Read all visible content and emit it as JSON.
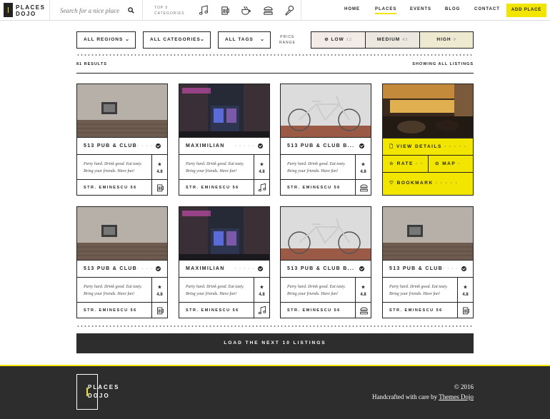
{
  "brand": {
    "line1": "PLACES",
    "line2": "DOJO"
  },
  "search": {
    "placeholder": "Search for a nice place"
  },
  "top_categories": {
    "line1": "TOP 5",
    "line2": "CATEGORIES",
    "icons": [
      "music-note-icon",
      "beer-mug-icon",
      "coffee-cup-icon",
      "burger-icon",
      "ice-cream-icon"
    ]
  },
  "nav": {
    "home": "HOME",
    "places": "PLACES",
    "events": "EVENTS",
    "blog": "BLOG",
    "contact": "CONTACT",
    "add_place": "ADD PLACE"
  },
  "filters": {
    "regions": "ALL REGIONS",
    "categories": "ALL CATEGORIES",
    "tags": "ALL TAGS",
    "price_label_1": "PRICE",
    "price_label_2": "RANGE"
  },
  "price": [
    {
      "label": "LOW",
      "count": "12"
    },
    {
      "label": "MEDIUM",
      "count": "43"
    },
    {
      "label": "HIGH",
      "count": "9"
    }
  ],
  "results": {
    "count": "81 RESULTS",
    "showing": "SHOWING ALL LISTINGS"
  },
  "cards": [
    {
      "title": "513 PUB & CLUB",
      "dots": "· · · ·",
      "desc": "Party hard. Drink good. Eat tasty. Bring your friends. Have fun!",
      "rating_star": "★",
      "rating": "4.8",
      "address": "STR. EMINESCU 56",
      "icon": "beer-mug-icon"
    },
    {
      "title": "MAXIMILIAN",
      "dots": "· · · · ·",
      "desc": "Party hard. Drink good. Eat tasty. Bring your friends. Have fun!",
      "rating_star": "★",
      "rating": "4.8",
      "address": "STR. EMINESCU 56",
      "icon": "music-note-icon"
    },
    {
      "title": "513 PUB & CLUB B...",
      "dots": "",
      "desc": "Party hard. Drink good. Eat tasty. Bring your friends. Have fun!",
      "rating_star": "★",
      "rating": "4.8",
      "address": "STR. EMINESCU 56",
      "icon": "burger-icon"
    },
    {
      "overlay": {
        "view": "VIEW DETAILS",
        "rate": "RATE",
        "map": "MAP",
        "bookmark": "BOOKMARK"
      }
    },
    {
      "title": "513 PUB & CLUB",
      "dots": "· · · ·",
      "desc": "Party hard. Drink good. Eat tasty. Bring your friends. Have fun!",
      "rating_star": "★",
      "rating": "4.8",
      "address": "STR. EMINESCU 56",
      "icon": "beer-mug-icon"
    },
    {
      "title": "MAXIMILIAN",
      "dots": "· · · · ·",
      "desc": "Party hard. Drink good. Eat tasty. Bring your friends. Have fun!",
      "rating_star": "★",
      "rating": "4.8",
      "address": "STR. EMINESCU 56",
      "icon": "music-note-icon"
    },
    {
      "title": "513 PUB & CLUB B...",
      "dots": "",
      "desc": "Party hard. Drink good. Eat tasty. Bring your friends. Have fun!",
      "rating_star": "★",
      "rating": "4.8",
      "address": "STR. EMINESCU 56",
      "icon": "burger-icon"
    },
    {
      "title": "513 PUB & CLUB",
      "dots": "· · · ·",
      "desc": "Party hard. Drink good. Eat tasty. Bring your friends. Have fun!",
      "rating_star": "★",
      "rating": "4.8",
      "address": "STR. EMINESCU 56",
      "icon": "beer-mug-icon"
    }
  ],
  "load_more": "LOAD THE NEXT 10 LISTINGS",
  "footer": {
    "logo_1": "PLACES",
    "logo_2": "DOJO",
    "copyright": "© 2016",
    "credit_prefix": "Handcrafted with care by ",
    "credit_link": "Themes Dojo"
  },
  "colors": {
    "accent": "#f2e600",
    "dark": "#2d2d2d",
    "low_bg": "#f5ebe6",
    "medium_bg": "#ece8df",
    "high_bg": "#eeead2"
  }
}
